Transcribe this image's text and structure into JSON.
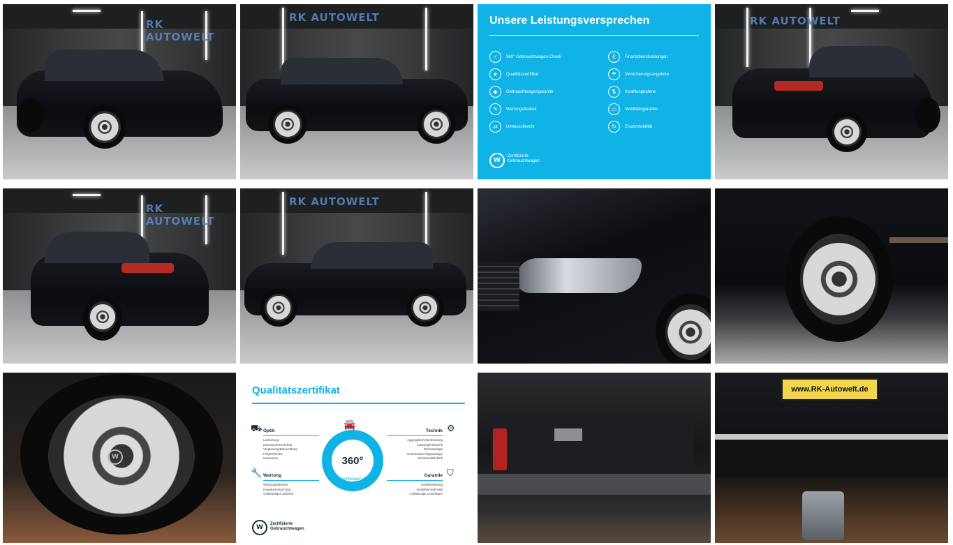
{
  "gallery": {
    "showroom_logo": "RK AUTOWELT",
    "tiles": [
      {
        "name": "photo-front-three-quarter"
      },
      {
        "name": "photo-side-profile-right"
      },
      {
        "name": "promise-tile"
      },
      {
        "name": "photo-rear-three-quarter-right"
      },
      {
        "name": "photo-rear-three-quarter-left"
      },
      {
        "name": "photo-side-profile-left"
      },
      {
        "name": "photo-headlight-closeup"
      },
      {
        "name": "photo-front-wheel-closeup"
      },
      {
        "name": "photo-rim-closeup"
      },
      {
        "name": "quality-certificate-tile"
      },
      {
        "name": "photo-trunk"
      },
      {
        "name": "photo-rear-plate"
      }
    ]
  },
  "promise": {
    "title": "Unsere Leistungsversprechen",
    "left": [
      "360° Gebrauchtwagen-Check",
      "Qualitätszertifikat",
      "Gebrauchtwagengarantie",
      "Wartungsfreiheit",
      "Umtauschrecht"
    ],
    "right": [
      "Finanzdienstleistungen",
      "Versicherungsangebote",
      "Inzahlungnahme",
      "Mobilitätsgarantie",
      "Ersatzmobilität"
    ],
    "cert_line1": "Zertifizierte",
    "cert_line2": "Gebrauchtwagen"
  },
  "quality": {
    "title": "Qualitätszertifikat",
    "ring_value": "360°",
    "ring_caption": "Gebrauchtwagen-Check",
    "optik": {
      "label": "Optik",
      "items": [
        "Lackierung",
        "Karosserie/Unterbau",
        "Verglasung/Beleuchtung",
        "Felgen/Reifen",
        "Innenraum"
      ]
    },
    "technik": {
      "label": "Technik",
      "items": [
        "Aggregate/Antriebsstrang",
        "Leistung/Fahrwerk",
        "Bremsanlage",
        "Unterboden/Abgasanlage",
        "Sicherheit/Elektrik"
      ]
    },
    "wartung": {
      "label": "Wartung",
      "items": [
        "Wartungsarbeiten",
        "Hauptuntersuchung",
        "vollständiges Zubehör"
      ]
    },
    "garantie": {
      "label": "Garantie",
      "items": [
        "Gewährleistung",
        "Qualitätsmerkmale",
        "vollständige Unterlagen"
      ]
    },
    "cert_line1": "Zertifizierte",
    "cert_line2": "Gebrauchtwagen"
  },
  "plate_text": "www.RK-Autowelt.de",
  "colors": {
    "accent_blue": "#0fb3e6",
    "car_black": "#0b0c10"
  }
}
